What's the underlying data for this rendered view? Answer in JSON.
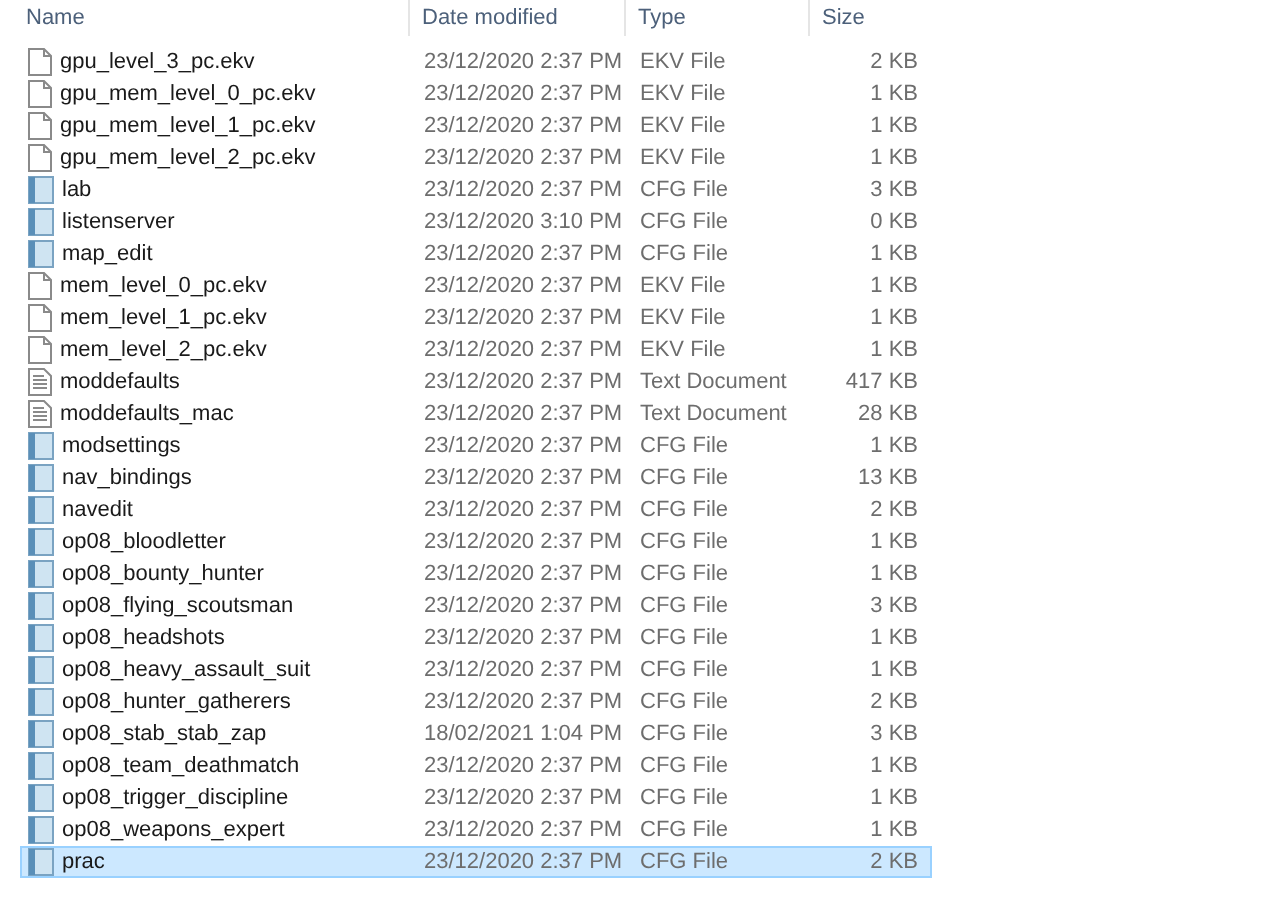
{
  "columns": [
    "Name",
    "Date modified",
    "Type",
    "Size"
  ],
  "rows": [
    {
      "name": "gpu_level_3_pc.ekv",
      "date": "23/12/2020 2:37 PM",
      "type": "EKV File",
      "size": "2 KB",
      "kind": "blank",
      "selected": false
    },
    {
      "name": "gpu_mem_level_0_pc.ekv",
      "date": "23/12/2020 2:37 PM",
      "type": "EKV File",
      "size": "1 KB",
      "kind": "blank",
      "selected": false
    },
    {
      "name": "gpu_mem_level_1_pc.ekv",
      "date": "23/12/2020 2:37 PM",
      "type": "EKV File",
      "size": "1 KB",
      "kind": "blank",
      "selected": false
    },
    {
      "name": "gpu_mem_level_2_pc.ekv",
      "date": "23/12/2020 2:37 PM",
      "type": "EKV File",
      "size": "1 KB",
      "kind": "blank",
      "selected": false
    },
    {
      "name": "lab",
      "date": "23/12/2020 2:37 PM",
      "type": "CFG File",
      "size": "3 KB",
      "kind": "config",
      "selected": false
    },
    {
      "name": "listenserver",
      "date": "23/12/2020 3:10 PM",
      "type": "CFG File",
      "size": "0 KB",
      "kind": "config",
      "selected": false
    },
    {
      "name": "map_edit",
      "date": "23/12/2020 2:37 PM",
      "type": "CFG File",
      "size": "1 KB",
      "kind": "config",
      "selected": false
    },
    {
      "name": "mem_level_0_pc.ekv",
      "date": "23/12/2020 2:37 PM",
      "type": "EKV File",
      "size": "1 KB",
      "kind": "blank",
      "selected": false
    },
    {
      "name": "mem_level_1_pc.ekv",
      "date": "23/12/2020 2:37 PM",
      "type": "EKV File",
      "size": "1 KB",
      "kind": "blank",
      "selected": false
    },
    {
      "name": "mem_level_2_pc.ekv",
      "date": "23/12/2020 2:37 PM",
      "type": "EKV File",
      "size": "1 KB",
      "kind": "blank",
      "selected": false
    },
    {
      "name": "moddefaults",
      "date": "23/12/2020 2:37 PM",
      "type": "Text Document",
      "size": "417 KB",
      "kind": "text",
      "selected": false
    },
    {
      "name": "moddefaults_mac",
      "date": "23/12/2020 2:37 PM",
      "type": "Text Document",
      "size": "28 KB",
      "kind": "text",
      "selected": false
    },
    {
      "name": "modsettings",
      "date": "23/12/2020 2:37 PM",
      "type": "CFG File",
      "size": "1 KB",
      "kind": "config",
      "selected": false
    },
    {
      "name": "nav_bindings",
      "date": "23/12/2020 2:37 PM",
      "type": "CFG File",
      "size": "13 KB",
      "kind": "config",
      "selected": false
    },
    {
      "name": "navedit",
      "date": "23/12/2020 2:37 PM",
      "type": "CFG File",
      "size": "2 KB",
      "kind": "config",
      "selected": false
    },
    {
      "name": "op08_bloodletter",
      "date": "23/12/2020 2:37 PM",
      "type": "CFG File",
      "size": "1 KB",
      "kind": "config",
      "selected": false
    },
    {
      "name": "op08_bounty_hunter",
      "date": "23/12/2020 2:37 PM",
      "type": "CFG File",
      "size": "1 KB",
      "kind": "config",
      "selected": false
    },
    {
      "name": "op08_flying_scoutsman",
      "date": "23/12/2020 2:37 PM",
      "type": "CFG File",
      "size": "3 KB",
      "kind": "config",
      "selected": false
    },
    {
      "name": "op08_headshots",
      "date": "23/12/2020 2:37 PM",
      "type": "CFG File",
      "size": "1 KB",
      "kind": "config",
      "selected": false
    },
    {
      "name": "op08_heavy_assault_suit",
      "date": "23/12/2020 2:37 PM",
      "type": "CFG File",
      "size": "1 KB",
      "kind": "config",
      "selected": false
    },
    {
      "name": "op08_hunter_gatherers",
      "date": "23/12/2020 2:37 PM",
      "type": "CFG File",
      "size": "2 KB",
      "kind": "config",
      "selected": false
    },
    {
      "name": "op08_stab_stab_zap",
      "date": "18/02/2021 1:04 PM",
      "type": "CFG File",
      "size": "3 KB",
      "kind": "config",
      "selected": false
    },
    {
      "name": "op08_team_deathmatch",
      "date": "23/12/2020 2:37 PM",
      "type": "CFG File",
      "size": "1 KB",
      "kind": "config",
      "selected": false
    },
    {
      "name": "op08_trigger_discipline",
      "date": "23/12/2020 2:37 PM",
      "type": "CFG File",
      "size": "1 KB",
      "kind": "config",
      "selected": false
    },
    {
      "name": "op08_weapons_expert",
      "date": "23/12/2020 2:37 PM",
      "type": "CFG File",
      "size": "1 KB",
      "kind": "config",
      "selected": false
    },
    {
      "name": "prac",
      "date": "23/12/2020 2:37 PM",
      "type": "CFG File",
      "size": "2 KB",
      "kind": "config",
      "selected": true
    }
  ]
}
